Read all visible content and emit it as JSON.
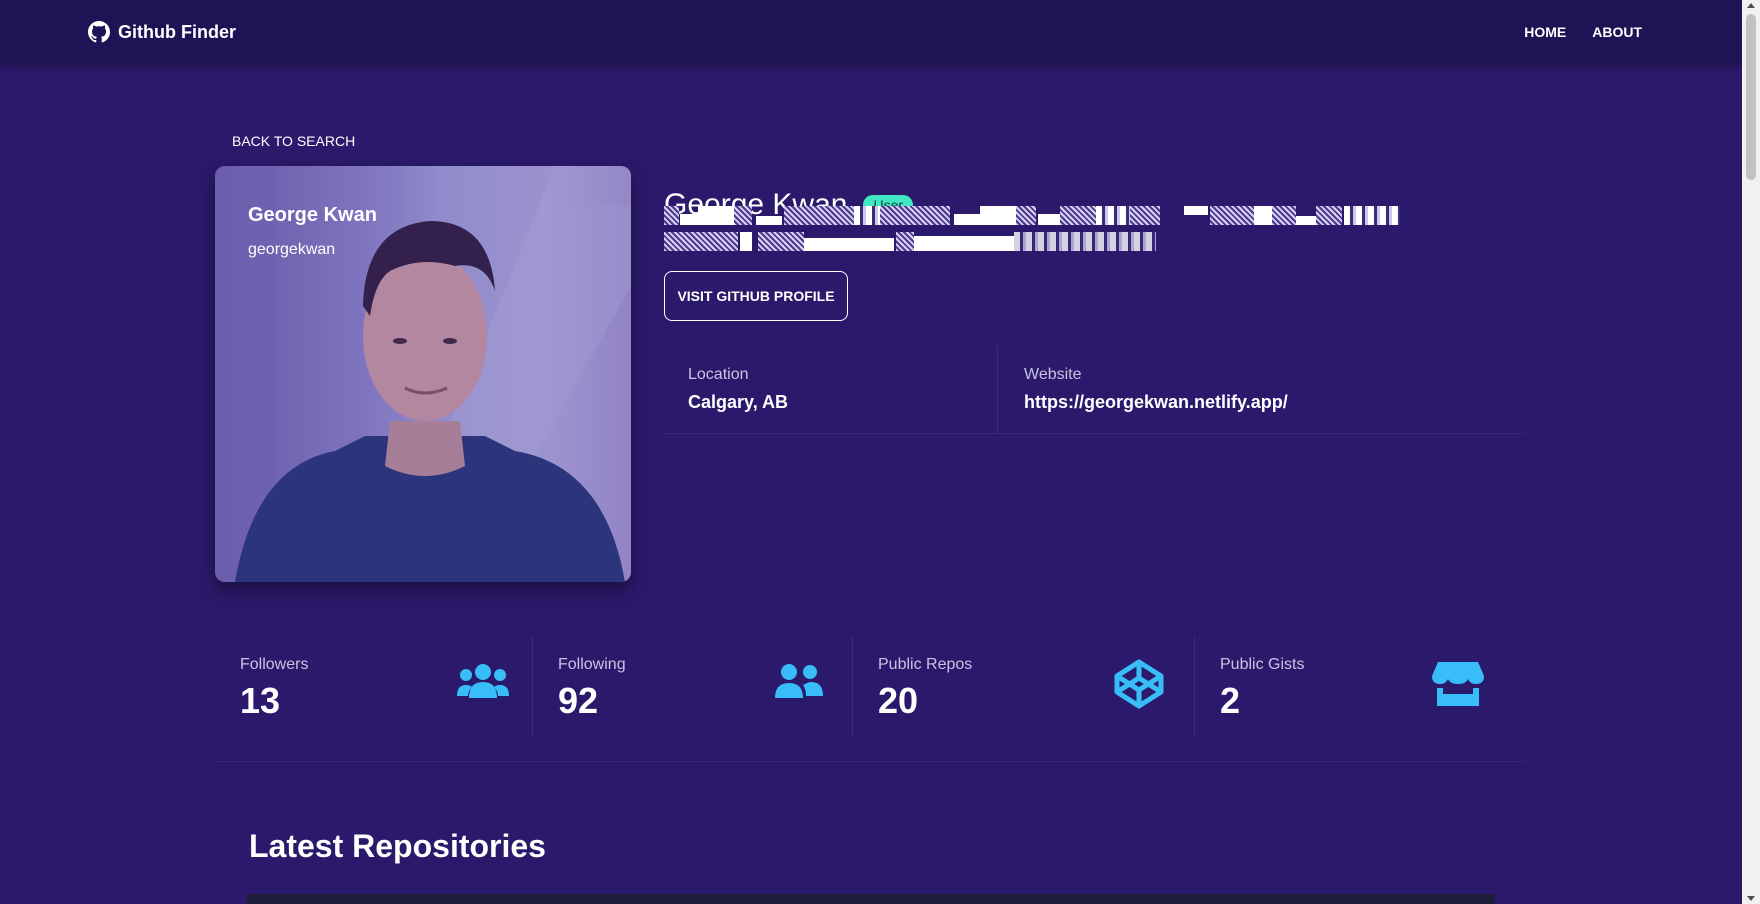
{
  "nav": {
    "brand": "Github Finder",
    "links": [
      "HOME",
      "ABOUT"
    ]
  },
  "back_link": "BACK TO SEARCH",
  "avatar": {
    "name": "George Kwan",
    "login": "georgekwan"
  },
  "profile": {
    "name": "George Kwan",
    "type_badge": "User",
    "visit_button": "VISIT GITHUB PROFILE"
  },
  "info": {
    "location_label": "Location",
    "location_value": "Calgary, AB",
    "website_label": "Website",
    "website_value": "https://georgekwan.netlify.app/"
  },
  "stats": [
    {
      "label": "Followers",
      "value": "13",
      "icon": "users-icon"
    },
    {
      "label": "Following",
      "value": "92",
      "icon": "user-friends-icon"
    },
    {
      "label": "Public Repos",
      "value": "20",
      "icon": "codepen-icon"
    },
    {
      "label": "Public Gists",
      "value": "2",
      "icon": "store-icon"
    }
  ],
  "repos": {
    "title": "Latest Repositories"
  },
  "colors": {
    "background": "#2b1a6b",
    "navbar": "#1e1354",
    "badge": "#3ee8c2",
    "stat_icon": "#38bdf8"
  }
}
